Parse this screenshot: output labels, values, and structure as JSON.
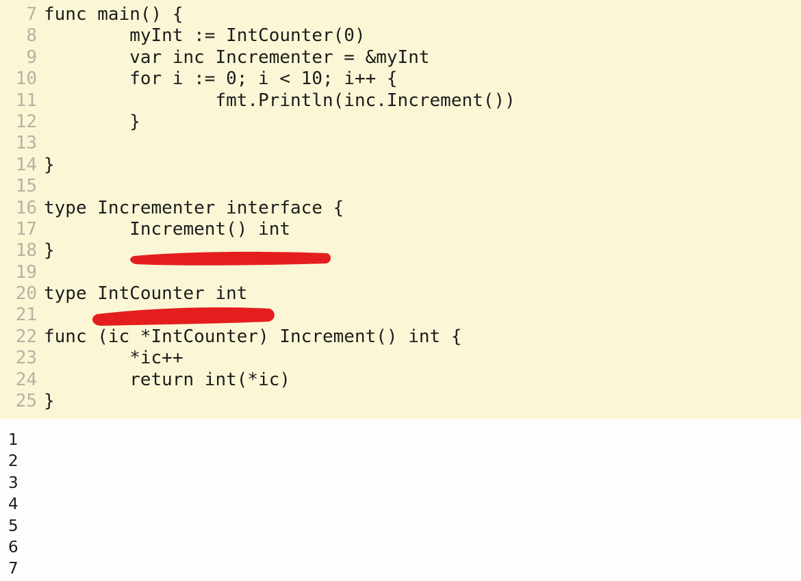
{
  "editor": {
    "lines": [
      {
        "n": "7",
        "code": "func main() {"
      },
      {
        "n": "8",
        "code": "        myInt := IntCounter(0)"
      },
      {
        "n": "9",
        "code": "        var inc Incrementer = &myInt"
      },
      {
        "n": "10",
        "code": "        for i := 0; i < 10; i++ {"
      },
      {
        "n": "11",
        "code": "                fmt.Println(inc.Increment())"
      },
      {
        "n": "12",
        "code": "        }"
      },
      {
        "n": "13",
        "code": ""
      },
      {
        "n": "14",
        "code": "}"
      },
      {
        "n": "15",
        "code": ""
      },
      {
        "n": "16",
        "code": "type Incrementer interface {"
      },
      {
        "n": "17",
        "code": "        Increment() int"
      },
      {
        "n": "18",
        "code": "}"
      },
      {
        "n": "19",
        "code": ""
      },
      {
        "n": "20",
        "code": "type IntCounter int"
      },
      {
        "n": "21",
        "code": ""
      },
      {
        "n": "22",
        "code": "func (ic *IntCounter) Increment() int {"
      },
      {
        "n": "23",
        "code": "        *ic++"
      },
      {
        "n": "24",
        "code": "        return int(*ic)"
      },
      {
        "n": "25",
        "code": "}"
      }
    ]
  },
  "output": {
    "lines": [
      "1",
      "2",
      "3",
      "4",
      "5",
      "6",
      "7"
    ]
  },
  "colors": {
    "editor_bg": "#fbf7d6",
    "annotation": "#e41e1e"
  }
}
